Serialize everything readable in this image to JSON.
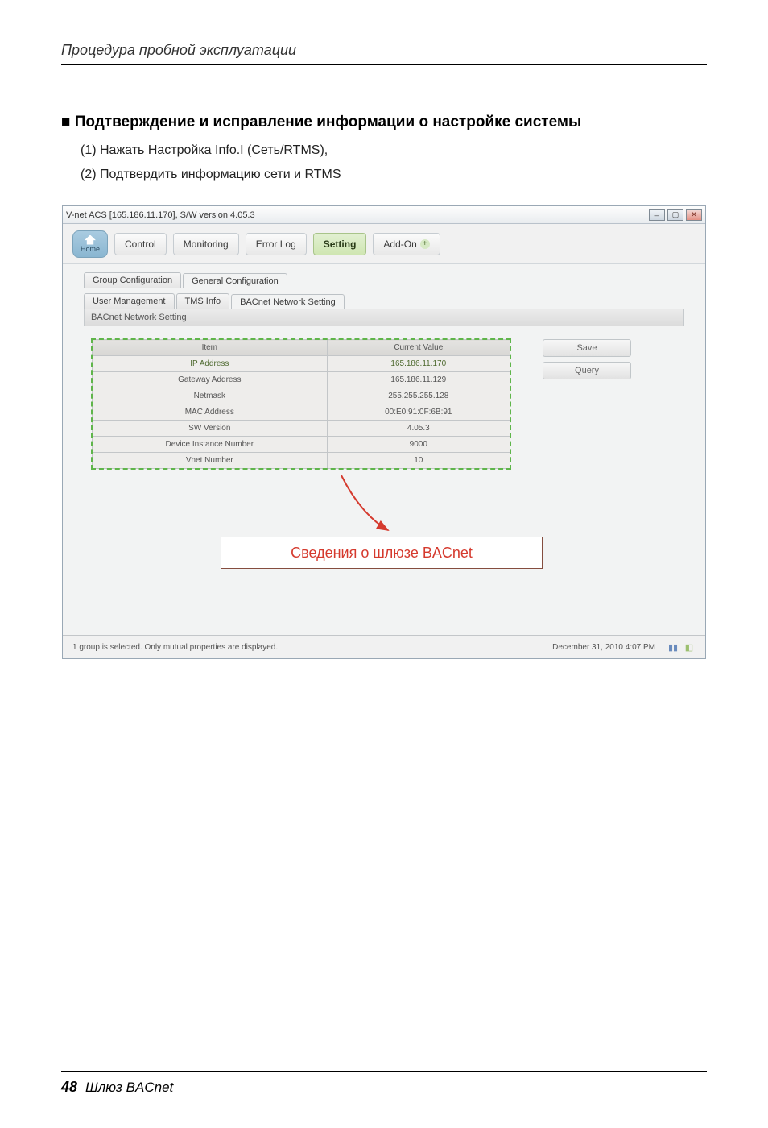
{
  "doc": {
    "running_head": "Процедура пробной эксплуатации",
    "section_title": "■ Подтверждение и исправление информации о настройке системы",
    "step1": "(1) Нажать Настройка Info.I (Сеть/RTMS),",
    "step2": "(2) Подтвердить информацию сети и RTMS",
    "page_number": "48",
    "product_name": "Шлюз BACnet"
  },
  "app": {
    "title": "V-net ACS [165.186.11.170],   S/W version 4.05.3",
    "titlebar_buttons": {
      "min": "–",
      "max": "▢",
      "close": "✕"
    },
    "home_label": "Home",
    "ribbon": {
      "control": "Control",
      "monitoring": "Monitoring",
      "error_log": "Error Log",
      "setting": "Setting",
      "addon": "Add-On"
    },
    "tabs_level1": {
      "group_config": "Group Configuration",
      "general_config": "General Configuration"
    },
    "tabs_level2": {
      "user_mgmt": "User Management",
      "tms_info": "TMS Info",
      "bacnet_net": "BACnet Network Setting"
    },
    "section_label": "BACnet Network Setting",
    "table_headers": {
      "item": "Item",
      "value": "Current Value"
    },
    "rows": [
      {
        "item": "IP Address",
        "value": "165.186.11.170"
      },
      {
        "item": "Gateway Address",
        "value": "165.186.11.129"
      },
      {
        "item": "Netmask",
        "value": "255.255.255.128"
      },
      {
        "item": "MAC Address",
        "value": "00:E0:91:0F:6B:91"
      },
      {
        "item": "SW Version",
        "value": "4.05.3"
      },
      {
        "item": "Device Instance Number",
        "value": "9000"
      },
      {
        "item": "Vnet Number",
        "value": "10"
      }
    ],
    "buttons": {
      "save": "Save",
      "query": "Query"
    },
    "status_left": "1 group is selected. Only mutual properties are displayed.",
    "status_right": "December 31, 2010  4:07 PM"
  },
  "callout": "Сведения о шлюзе BACnet",
  "colors": {
    "accent_green": "#5fb54a",
    "callout_text": "#d53a2e",
    "callout_border": "#854d3f"
  }
}
